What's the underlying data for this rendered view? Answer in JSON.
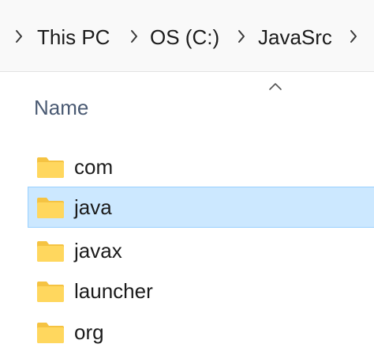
{
  "breadcrumb": {
    "items": [
      {
        "label": "This PC"
      },
      {
        "label": "OS (C:)"
      },
      {
        "label": "JavaSrc"
      }
    ]
  },
  "columns": {
    "name_header": "Name",
    "sort_direction": "ascending"
  },
  "files": [
    {
      "name": "com",
      "type": "folder",
      "selected": false
    },
    {
      "name": "java",
      "type": "folder",
      "selected": true
    },
    {
      "name": "javax",
      "type": "folder",
      "selected": false
    },
    {
      "name": "launcher",
      "type": "folder",
      "selected": false
    },
    {
      "name": "org",
      "type": "folder",
      "selected": false
    }
  ],
  "colors": {
    "selection_bg": "#cce8ff",
    "selection_border": "#99d1ff",
    "folder_fill": "#ffd75e",
    "folder_tab": "#f5c342",
    "header_text": "#4a5a73"
  },
  "icons": {
    "separator": "chevron-right-icon",
    "sort": "chevron-up-icon",
    "folder": "folder-icon"
  }
}
